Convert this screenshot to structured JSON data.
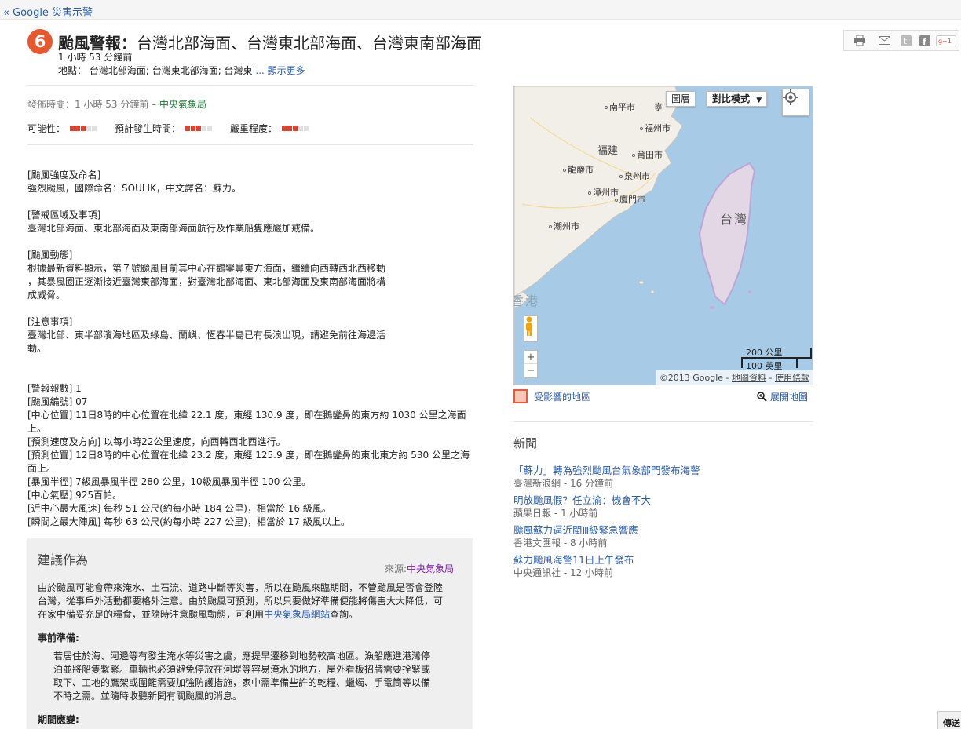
{
  "topbar": {
    "back_link": "« Google 災害示警"
  },
  "alert": {
    "icon_glyph": "6",
    "title_type": "颱風警報：",
    "title_areas": "台灣北部海面、台灣東北部海面、台灣東南部海面",
    "time_ago": "1 小時 53 分鐘前",
    "locations_label": "地點：",
    "locations_value": "台灣北部海面; 台灣東北部海面; 台灣東",
    "locations_more": " ... 顯示更多"
  },
  "share": {
    "icons": [
      "print-icon",
      "email-icon",
      "twitter-icon",
      "facebook-icon",
      "google-plus-icon"
    ]
  },
  "published": {
    "prefix": "發佈時間：1 小時 53 分鐘前 – ",
    "source": "中央氣象局"
  },
  "meters": [
    {
      "label": "可能性：",
      "level": 3,
      "max": 5
    },
    {
      "label": "預計發生時間：",
      "level": 3,
      "max": 5
    },
    {
      "label": "嚴重程度：",
      "level": 3,
      "max": 5
    }
  ],
  "body_sections": [
    "[颱風強度及命名]\n強烈颱風，國際命名：SOULIK，中文譯名：蘇力。",
    "[警戒區域及事項]\n臺灣北部海面、東北部海面及東南部海面航行及作業船隻應嚴加戒備。",
    "[颱風動態]\n根據最新資料顯示，第７號颱風目前其中心在鵝鑾鼻東方海面，繼續向西轉西北西移動\n，其暴風圈正逐漸接近臺灣東部海面，對臺灣北部海面、東北部海面及東南部海面將構\n成威脅。",
    "[注意事項]\n臺灣北部、東半部濱海地區及綠島、蘭嶼、恆春半島已有長浪出現，請避免前往海邊活\n動。"
  ],
  "details": [
    "[警報報數] 1",
    "[颱風編號] 07",
    "[中心位置] 11日8時的中心位置在北緯 22.1 度，東經 130.9 度，即在鵝鑾鼻的東方約 1030 公里之海面上。",
    "[預測速度及方向] 以每小時22公里速度，向西轉西北西進行。",
    "[預測位置] 12日8時的中心位置在北緯 23.2 度，東經 125.9 度，即在鵝鑾鼻的東北東方約 530 公里之海面上。",
    "[暴風半徑] 7級風暴風半徑 280 公里，10級風暴風半徑 100 公里。",
    "[中心氣壓] 925百帕。",
    "[近中心最大風速] 每秒 51 公尺(約每小時 184 公里)，相當於 16 級風。",
    "[瞬間之最大陣風] 每秒 63 公尺(約每小時 227 公里)，相當於 17 級風以上。"
  ],
  "recommend": {
    "title": "建議作為",
    "source_prefix": "來源:",
    "source": "中央氣象局",
    "intro_part1": "由於颱風可能會帶來淹水、土石流、道路中斷等災害，所以在颱風來臨期間，不管颱風是否會登陸台灣，從事戶外活動都要格外注意。由於颱風可預測，所以只要做好準備便能將傷害大大降低，可在家中備妥充足的糧食，並隨時注意颱風動態，可利用",
    "intro_link": "中央氣象局網站",
    "intro_part2": "查詢。",
    "before_heading": "事前準備:",
    "before_text": "若居住於海、河邊等有發生淹水等災害之虞，應提早遷移到地勢較高地區。漁船應進港灣停泊並將船隻繫緊。車輛也必須避免停放在河堤等容易淹水的地方，屋外看板招牌需要拴緊或取下、工地的鷹架或圍籬需要加強防護措施，家中需準備些許的乾糧、蠟燭、手電筒等以備不時之需。並隨時收聽新聞有關颱風的消息。",
    "during_heading": "期間應變:"
  },
  "map": {
    "layers_button": "圖層",
    "mode_button": "對比模式",
    "labels": {
      "nanping": "南平市",
      "ningde": "寧",
      "fuzhou": "福州市",
      "fujian": "福建",
      "putian": "莆田市",
      "longyan": "龍巖市",
      "quanzhou": "泉州市",
      "zhangzhou": "漳州市",
      "xiamen": "廈門市",
      "chaozhou": "潮州市",
      "taiwan": "台灣",
      "hongkong": "香港"
    },
    "scale_km": "200 公里",
    "scale_mi": "100 英里",
    "copyright_prefix": "©2013 Google - ",
    "map_data": "地圖資料",
    "terms": "使用條款",
    "colors": {
      "water": "#a7cbe6",
      "land": "#f2efe9",
      "affected": "#c8a8e0"
    }
  },
  "legend": {
    "label": "受影響的地區",
    "expand": "展開地圖"
  },
  "news": {
    "heading": "新聞",
    "items": [
      {
        "title": "「蘇力」轉為強烈颱風台氣象部門發布海警",
        "source": "臺灣新浪網 - 16 分鐘前"
      },
      {
        "title": "明放颱風假？任立渝：機會不大",
        "source": "蘋果日報 - 1 小時前"
      },
      {
        "title": "颱風蘇力逼近閩Ⅲ級緊急響應",
        "source": "香港文匯報 - 8 小時前"
      },
      {
        "title": "蘇力颱風海警11日上午發布",
        "source": "中央通訊社 - 12 小時前"
      }
    ]
  },
  "corner": {
    "label": "傳送"
  }
}
